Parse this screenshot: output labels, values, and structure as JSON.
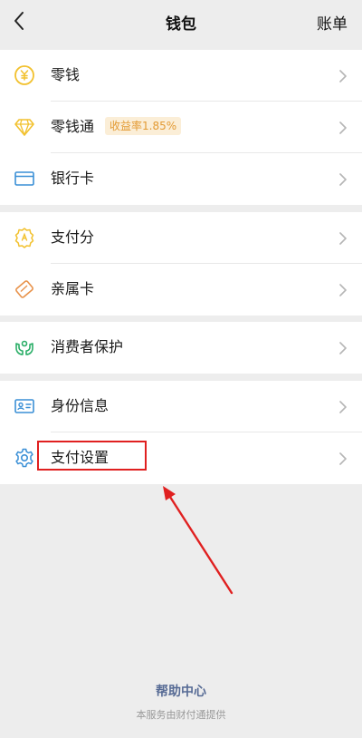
{
  "header": {
    "title": "钱包",
    "right_action": "账单"
  },
  "groups": [
    {
      "items": [
        {
          "label": "零钱",
          "icon": "coin-icon"
        },
        {
          "label": "零钱通",
          "icon": "diamond-icon",
          "badge": "收益率1.85%"
        },
        {
          "label": "银行卡",
          "icon": "bank-card-icon"
        }
      ]
    },
    {
      "items": [
        {
          "label": "支付分",
          "icon": "payment-score-icon"
        },
        {
          "label": "亲属卡",
          "icon": "family-card-icon"
        }
      ]
    },
    {
      "items": [
        {
          "label": "消费者保护",
          "icon": "consumer-protection-icon"
        }
      ]
    },
    {
      "items": [
        {
          "label": "身份信息",
          "icon": "id-card-icon"
        },
        {
          "label": "支付设置",
          "icon": "gear-icon"
        }
      ]
    }
  ],
  "footer": {
    "help": "帮助中心",
    "note": "本服务由财付通提供"
  },
  "colors": {
    "accent_yellow": "#f2c12e",
    "accent_green": "#2aae67",
    "accent_blue": "#3a8fd6",
    "accent_orange": "#e8924a",
    "highlight_red": "#e02020",
    "link_blue": "#576b95"
  }
}
